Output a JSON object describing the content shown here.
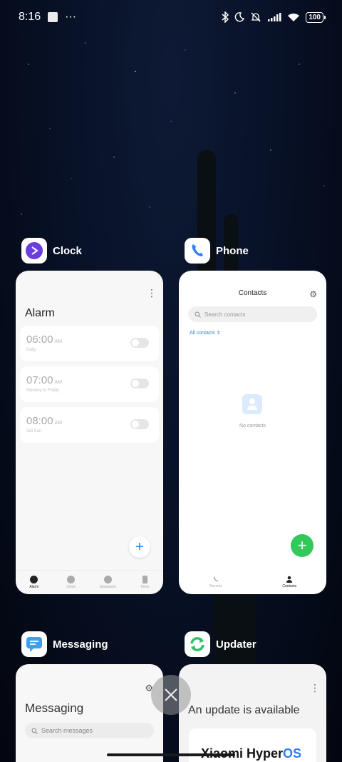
{
  "status_bar": {
    "time": "8:16",
    "dots": "···",
    "battery": "100",
    "icons": [
      "notification-square-icon",
      "bluetooth-icon",
      "moon-icon",
      "bell-muted-icon",
      "signal-icon",
      "wifi-icon",
      "battery-icon"
    ]
  },
  "apps": [
    {
      "name": "Clock",
      "icon": "clock-app-icon",
      "accent": "#6b3de0"
    },
    {
      "name": "Phone",
      "icon": "phone-app-icon",
      "accent": "#2f7cf6"
    },
    {
      "name": "Messaging",
      "icon": "messaging-app-icon",
      "accent": "#3aa0f0"
    },
    {
      "name": "Updater",
      "icon": "updater-app-icon",
      "accent": "#2fc26b"
    }
  ],
  "clock": {
    "title": "Alarm",
    "alarms": [
      {
        "time": "06:00",
        "ampm": "AM",
        "repeat": "Daily",
        "enabled": false
      },
      {
        "time": "07:00",
        "ampm": "AM",
        "repeat": "Monday to Friday",
        "enabled": false
      },
      {
        "time": "08:00",
        "ampm": "AM",
        "repeat": "Sat Sun",
        "enabled": false
      }
    ],
    "tabs": [
      "Alarm",
      "Clock",
      "Stopwatch",
      "Timer"
    ]
  },
  "phone": {
    "title": "Contacts",
    "search_placeholder": "Search contacts",
    "filter": "All contacts",
    "empty_text": "No contacts",
    "tabs": [
      "Recents",
      "Contacts"
    ]
  },
  "messaging": {
    "title": "Messaging",
    "search_placeholder": "Search messages"
  },
  "updater": {
    "title": "An update is available",
    "brand_prefix": "Xiaomi Hyper",
    "brand_suffix": "OS"
  },
  "colors": {
    "accent_blue": "#2f7cf6",
    "accent_green": "#33c85a"
  }
}
